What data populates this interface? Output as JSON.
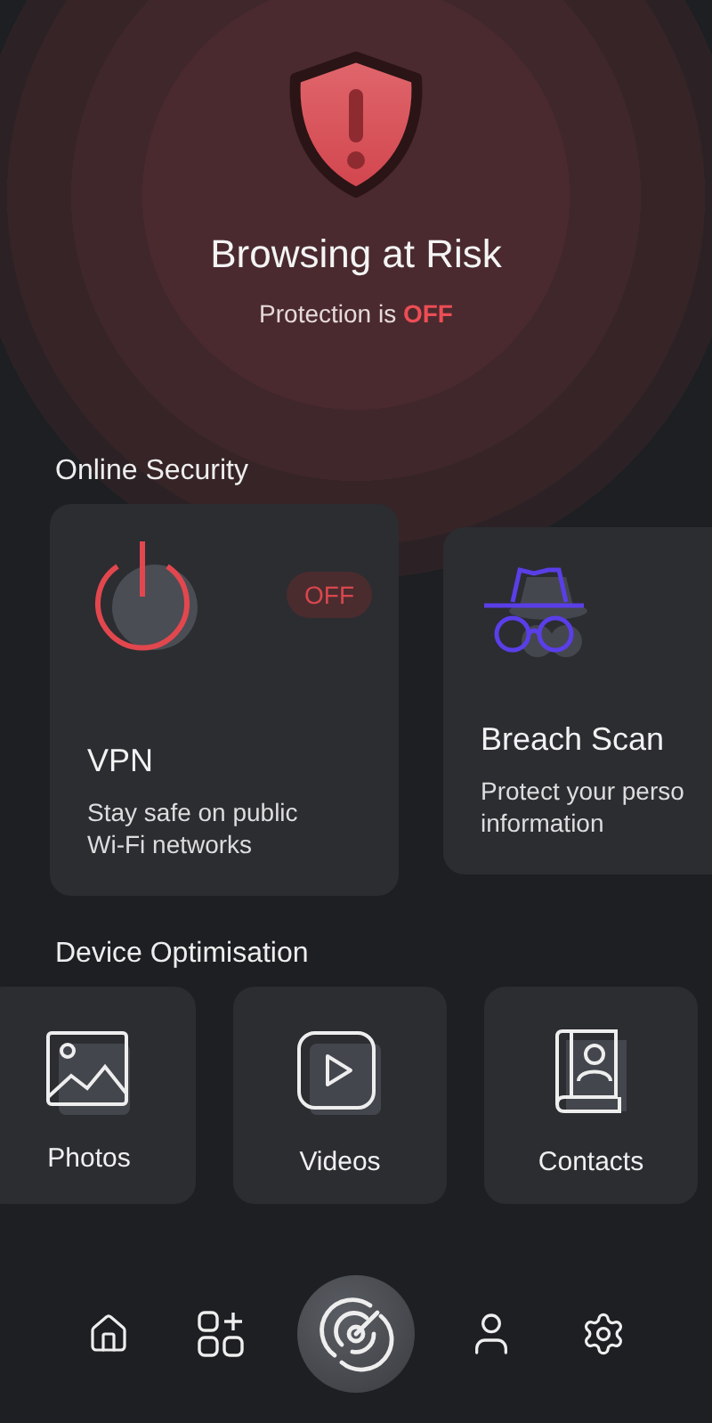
{
  "hero": {
    "title": "Browsing at Risk",
    "status_prefix": "Protection is",
    "status_value": "OFF",
    "protected": false
  },
  "online_security": {
    "heading": "Online Security",
    "cards": [
      {
        "kind": "vpn",
        "title": "VPN",
        "description": "Stay safe on public Wi-Fi networks",
        "on": false,
        "badge": "OFF"
      },
      {
        "kind": "breach",
        "title": "Breach Scan",
        "description": "Protect your perso information"
      }
    ]
  },
  "device_optimisation": {
    "heading": "Device Optimisation",
    "items": [
      {
        "kind": "photos",
        "label": "Photos"
      },
      {
        "kind": "videos",
        "label": "Videos"
      },
      {
        "kind": "contacts",
        "label": "Contacts"
      }
    ]
  },
  "nav": [
    {
      "kind": "home"
    },
    {
      "kind": "apps"
    },
    {
      "kind": "scan"
    },
    {
      "kind": "profile"
    },
    {
      "kind": "settings"
    }
  ]
}
